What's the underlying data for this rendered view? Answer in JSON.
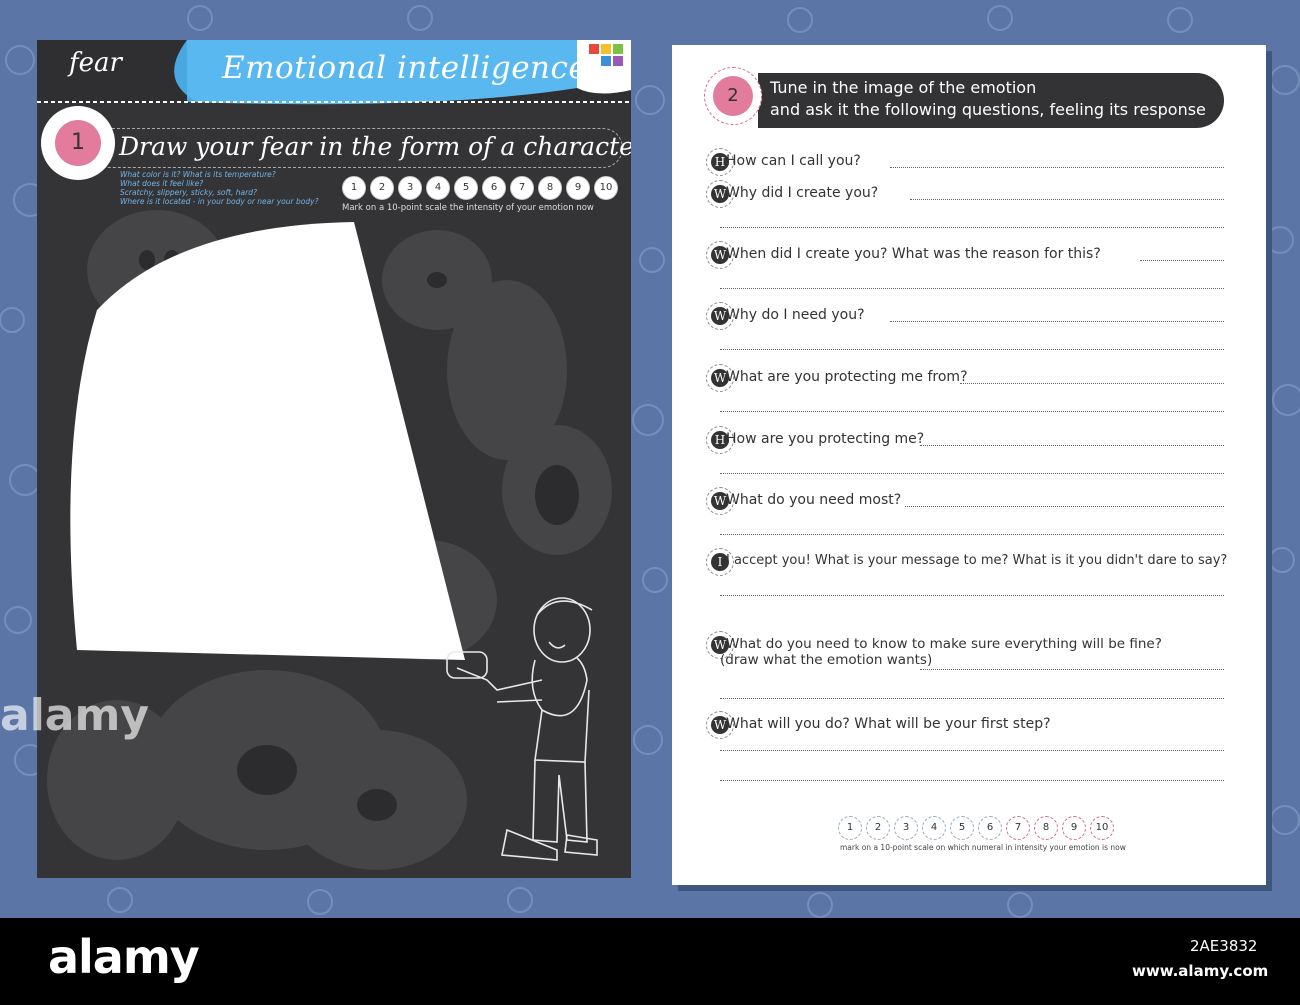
{
  "left_page": {
    "tag": "fear",
    "title": "Emotional intelligence",
    "task_number": "1",
    "task_title": "Draw your fear in the form of a character",
    "hints": [
      "What color is it? What is its temperature?",
      "What does it feel like?",
      "Scratchy, slippery, sticky, soft, hard?",
      "Where is it located - in your body or near your body?"
    ],
    "scale": [
      "1",
      "2",
      "3",
      "4",
      "5",
      "6",
      "7",
      "8",
      "9",
      "10"
    ],
    "scale_caption": "Mark on a 10-point scale the intensity of your emotion now"
  },
  "right_page": {
    "task_number": "2",
    "task_title_line1": "Tune in the image of the emotion",
    "task_title_line2": "and ask it the following questions, feeling its response",
    "questions": [
      {
        "cap": "H",
        "text": "How can I call you?"
      },
      {
        "cap": "W",
        "text": "Why did I create you?"
      },
      {
        "cap": "W",
        "text": "When did I create you? What was the reason for this?"
      },
      {
        "cap": "W",
        "text": "Why do I need you?"
      },
      {
        "cap": "W",
        "text": "What are you protecting me from?"
      },
      {
        "cap": "H",
        "text": "How are you protecting me?"
      },
      {
        "cap": "W",
        "text": "What do you need most?"
      },
      {
        "cap": "I",
        "text": "I accept you! What is your message to me? What is it you didn't dare to say?"
      },
      {
        "cap": "W",
        "text": "What do you need to know to make sure everything will be fine?"
      },
      {
        "cap": "W",
        "text": "What will you do? What will be your first step?"
      }
    ],
    "question_note": "(draw what the emotion wants)",
    "scale": [
      "1",
      "2",
      "3",
      "4",
      "5",
      "6",
      "7",
      "8",
      "9",
      "10"
    ],
    "scale_caption": "mark on a 10-point scale on which numeral in intensity your emotion is now"
  },
  "watermark": {
    "logo": "alamy",
    "side_logo": "alamy",
    "code": "2AE3832",
    "url": "www.alamy.com"
  },
  "colors": {
    "background": "#5b76a6",
    "left_page": "#343437",
    "accent_pink": "#e27b9c",
    "hint_blue": "#74b3e6"
  }
}
